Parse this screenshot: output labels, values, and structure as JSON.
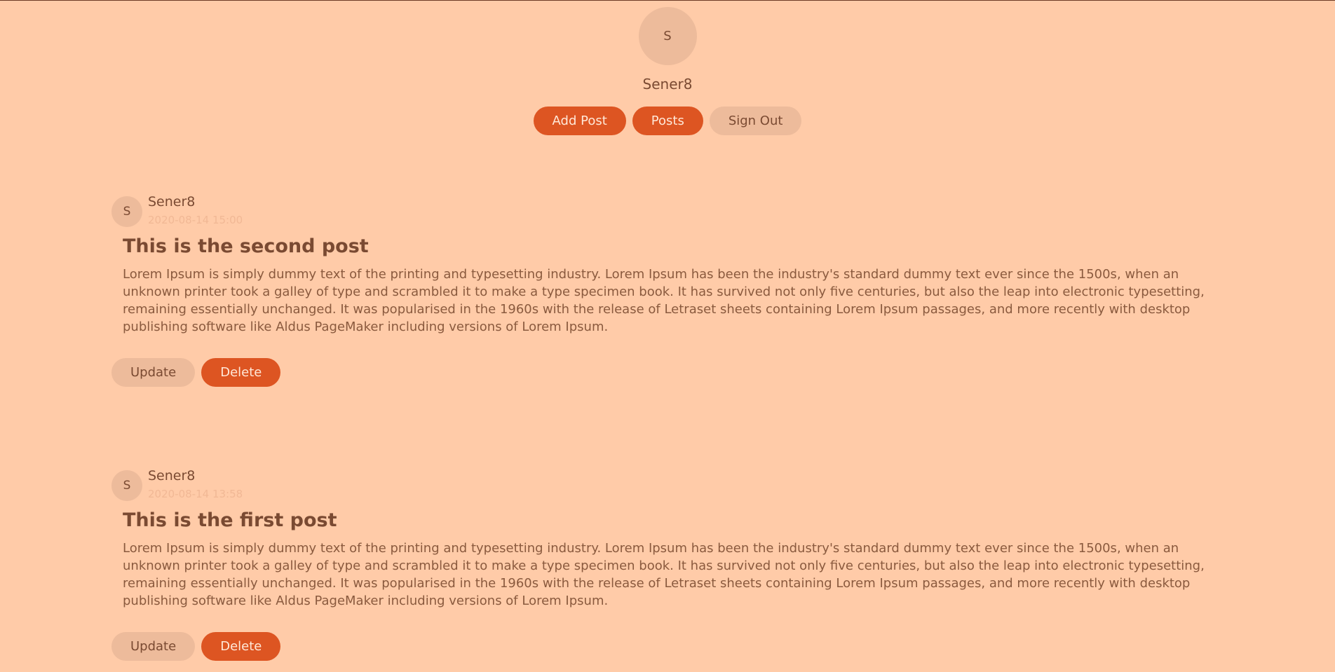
{
  "user": {
    "avatar_initial": "S",
    "username": "Sener8"
  },
  "nav": {
    "add_post_label": "Add Post",
    "posts_label": "Posts",
    "sign_out_label": "Sign Out"
  },
  "posts": [
    {
      "avatar_initial": "S",
      "author": "Sener8",
      "date": "2020-08-14 15:00",
      "title": "This is the second post",
      "body": "Lorem Ipsum is simply dummy text of the printing and typesetting industry. Lorem Ipsum has been the industry's standard dummy text ever since the 1500s, when an unknown printer took a galley of type and scrambled it to make a type specimen book. It has survived not only five centuries, but also the leap into electronic typesetting, remaining essentially unchanged. It was popularised in the 1960s with the release of Letraset sheets containing Lorem Ipsum passages, and more recently with desktop publishing software like Aldus PageMaker including versions of Lorem Ipsum.",
      "update_label": "Update",
      "delete_label": "Delete"
    },
    {
      "avatar_initial": "S",
      "author": "Sener8",
      "date": "2020-08-14 13:58",
      "title": "This is the first post",
      "body": "Lorem Ipsum is simply dummy text of the printing and typesetting industry. Lorem Ipsum has been the industry's standard dummy text ever since the 1500s, when an unknown printer took a galley of type and scrambled it to make a type specimen book. It has survived not only five centuries, but also the leap into electronic typesetting, remaining essentially unchanged. It was popularised in the 1960s with the release of Letraset sheets containing Lorem Ipsum passages, and more recently with desktop publishing software like Aldus PageMaker including versions of Lorem Ipsum.",
      "update_label": "Update",
      "delete_label": "Delete"
    }
  ],
  "colors": {
    "background": "#FFCBA8",
    "primary": "#DD5522",
    "secondary": "#EDBB9B",
    "text": "#7a4a32"
  }
}
